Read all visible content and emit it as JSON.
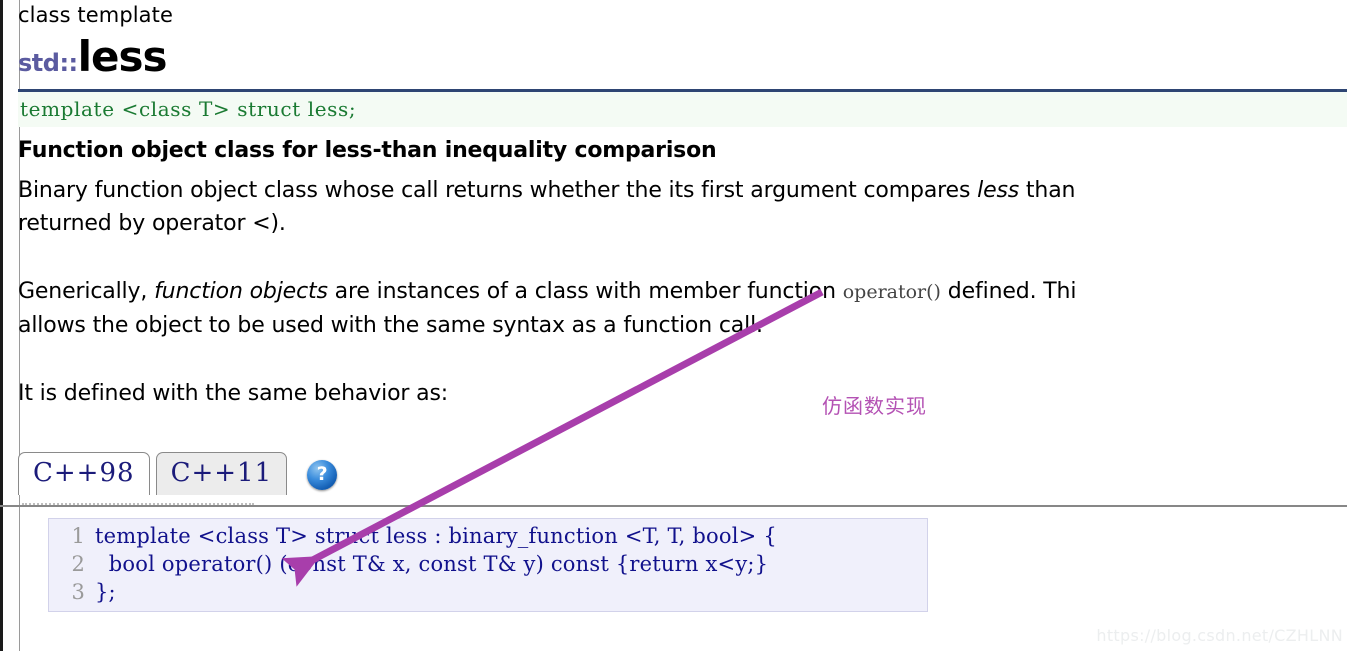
{
  "page": {
    "kicker": "class template",
    "namespace": "std::",
    "name": "less"
  },
  "signature": "template <class T> struct less;",
  "brief": "Function object class for less-than inequality comparison",
  "paragraphs": {
    "binary_line1_a": "Binary function object class whose call returns whether the its first argument compares ",
    "binary_line1_em": "less",
    "binary_line1_b": " than",
    "binary_line2": "returned by operator <).",
    "generic_line1_a": "Generically, ",
    "generic_line1_em": "function objects",
    "generic_line1_b": " are instances of a class with member function ",
    "generic_line1_mono": "operator()",
    "generic_line1_c": " defined. Thi",
    "generic_line2": "allows the object to be used with the same syntax as a function call.",
    "defined_line": "It is defined with the same behavior as:"
  },
  "annotation": {
    "chinese_note": "仿函数实现",
    "note_color": "#b452b4",
    "arrow_color": "#a83eab"
  },
  "tabs": [
    {
      "label": "C++98",
      "active": true
    },
    {
      "label": "C++11",
      "active": false
    }
  ],
  "help_icon": {
    "glyph": "?",
    "name": "help-icon"
  },
  "code": {
    "lines": [
      {
        "number": "1",
        "text": "template <class T> struct less : binary_function <T, T, bool> {"
      },
      {
        "number": "2",
        "text": "  bool operator() (const T& x, const T& y) const {return x<y;}"
      },
      {
        "number": "3",
        "text": "};"
      }
    ]
  },
  "watermark": "https://blog.csdn.net/CZHLNN",
  "colors": {
    "namespace": "#5b5ba0",
    "signature_text": "#1a7a32",
    "signature_bg": "#f4fbf4",
    "rule": "#2e4573",
    "code_bg": "#f0f0fb",
    "code_text": "#11118c",
    "tab_text": "#1b1b7a"
  }
}
